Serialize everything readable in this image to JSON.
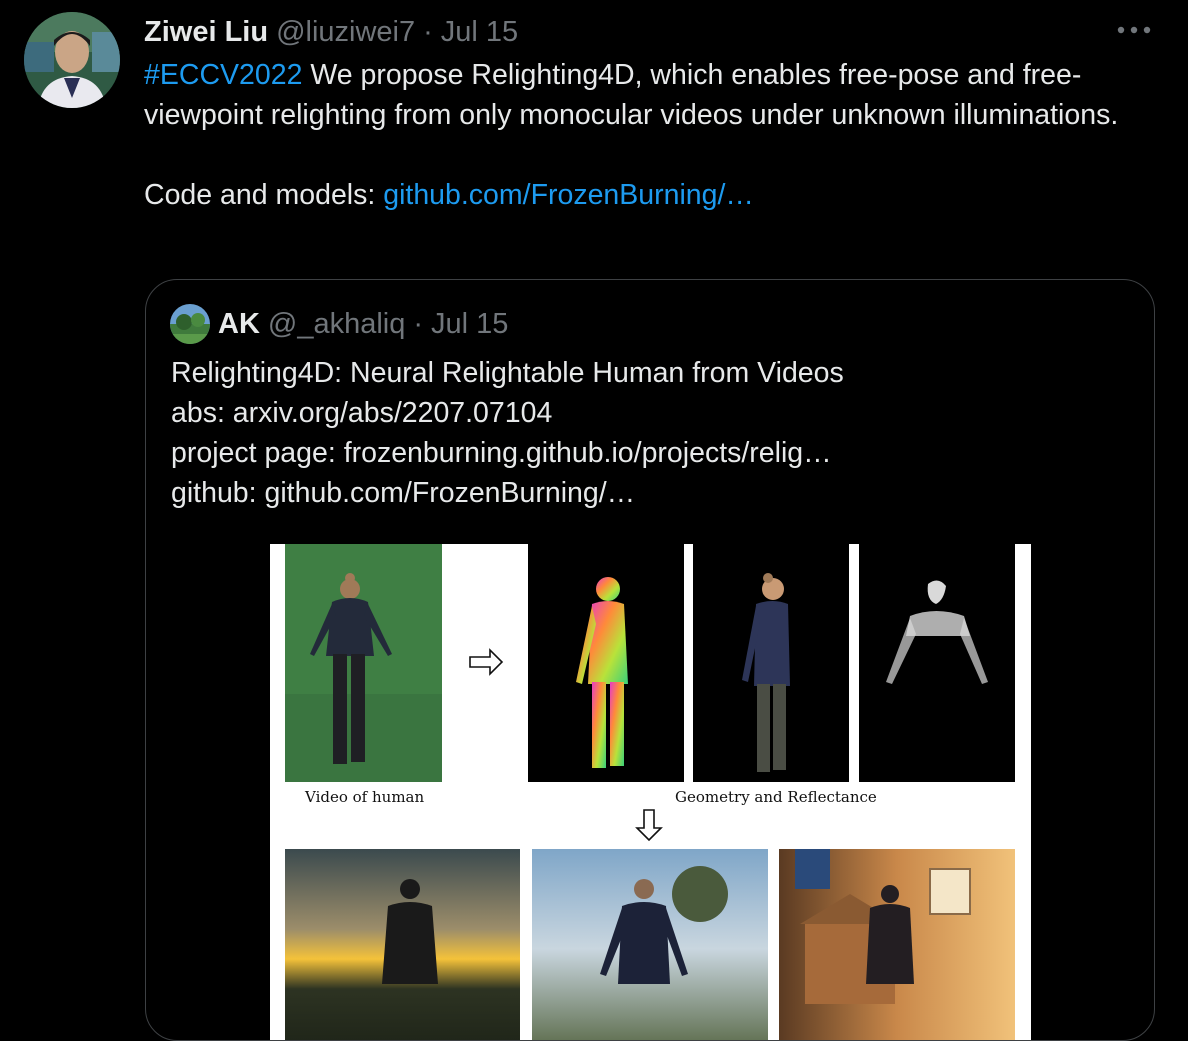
{
  "author": {
    "name": "Ziwei Liu",
    "handle": "@liuziwei7",
    "date": "Jul 15",
    "separator": "·"
  },
  "more_icon": "more-icon",
  "tweet": {
    "hashtag": "#ECCV2022",
    "line1_rest": " We propose Relighting4D, which enables free-pose and free-viewpoint relighting from only monocular videos under unknown illuminations.",
    "code_label": "Code and models: ",
    "code_link": "github.com/FrozenBurning/…"
  },
  "quote": {
    "name": "AK",
    "handle": "@_akhaliq",
    "date": "Jul 15",
    "separator": "·",
    "lines": [
      "Relighting4D: Neural Relightable Human from Videos",
      "abs: arxiv.org/abs/2207.07104",
      "project page: frozenburning.github.io/projects/relig…",
      "github: github.com/FrozenBurning/…"
    ]
  },
  "figure": {
    "caption_video": "Video of human",
    "caption_geometry": "Geometry and Reflectance"
  },
  "colors": {
    "background": "#000000",
    "text": "#e7e9ea",
    "muted": "#71767b",
    "link": "#1d9bf0",
    "border": "#3e4144"
  }
}
